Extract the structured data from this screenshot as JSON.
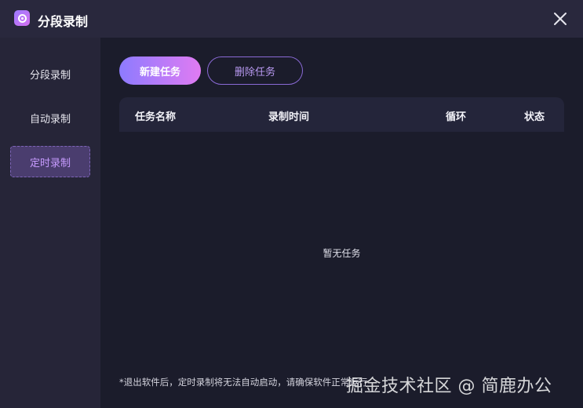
{
  "window": {
    "title": "分段录制"
  },
  "sidebar": {
    "items": [
      {
        "label": "分段录制",
        "active": false
      },
      {
        "label": "自动录制",
        "active": false
      },
      {
        "label": "定时录制",
        "active": true
      }
    ]
  },
  "toolbar": {
    "new_task_label": "新建任务",
    "delete_task_label": "删除任务"
  },
  "table": {
    "columns": [
      "任务名称",
      "录制时间",
      "循环",
      "状态"
    ],
    "empty_text": "暂无任务"
  },
  "notice": "*退出软件后，定时录制将无法自动启动，请确保软件正常运行",
  "watermark": "掘金技术社区 @ 简鹿办公",
  "colors": {
    "accent_start": "#8d7bff",
    "accent_end": "#e07bf2",
    "active_text": "#c79bff"
  }
}
